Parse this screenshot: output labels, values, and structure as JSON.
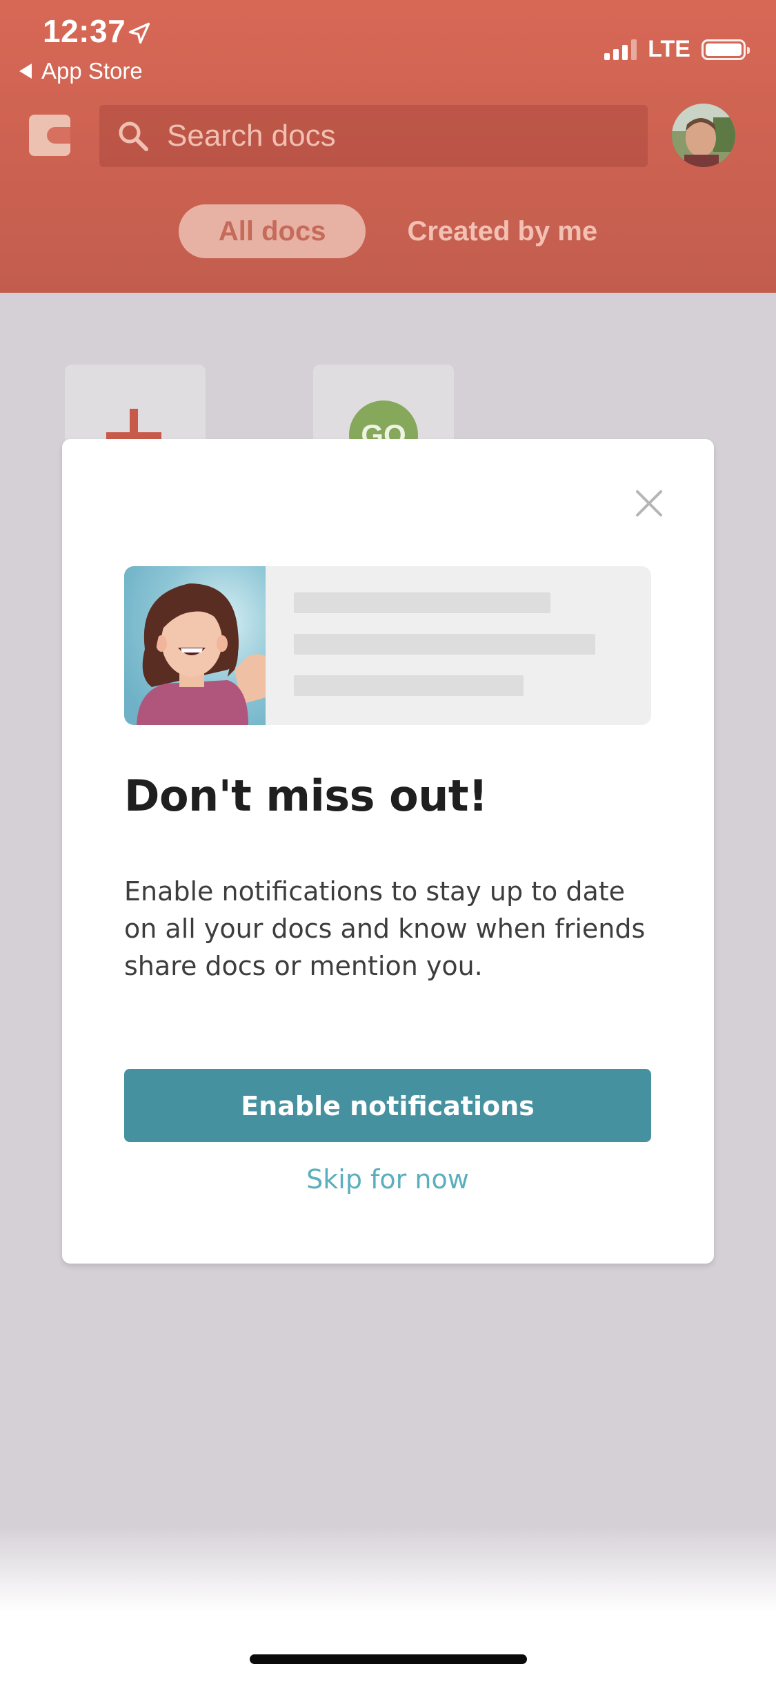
{
  "status_bar": {
    "time": "12:37",
    "back_label": "App Store",
    "network": "LTE",
    "signal_bars": 3
  },
  "header": {
    "search_placeholder": "Search docs",
    "tabs": [
      {
        "label": "All docs",
        "active": true
      },
      {
        "label": "Created by me",
        "active": false
      }
    ]
  },
  "doc_cards": [
    {
      "type": "new-doc",
      "icon": "plus-icon"
    },
    {
      "type": "doc",
      "badge": "GO"
    }
  ],
  "modal": {
    "title": "Don't miss out!",
    "body": "Enable notifications to stay up to date on all your docs and know when friends share docs or mention you.",
    "primary_button": "Enable notifications",
    "secondary_link": "Skip for now"
  },
  "colors": {
    "header": "#e66f5c",
    "accent_button": "#4691a0",
    "link": "#5aaebd",
    "overlay_background": "#d5d0d6"
  }
}
